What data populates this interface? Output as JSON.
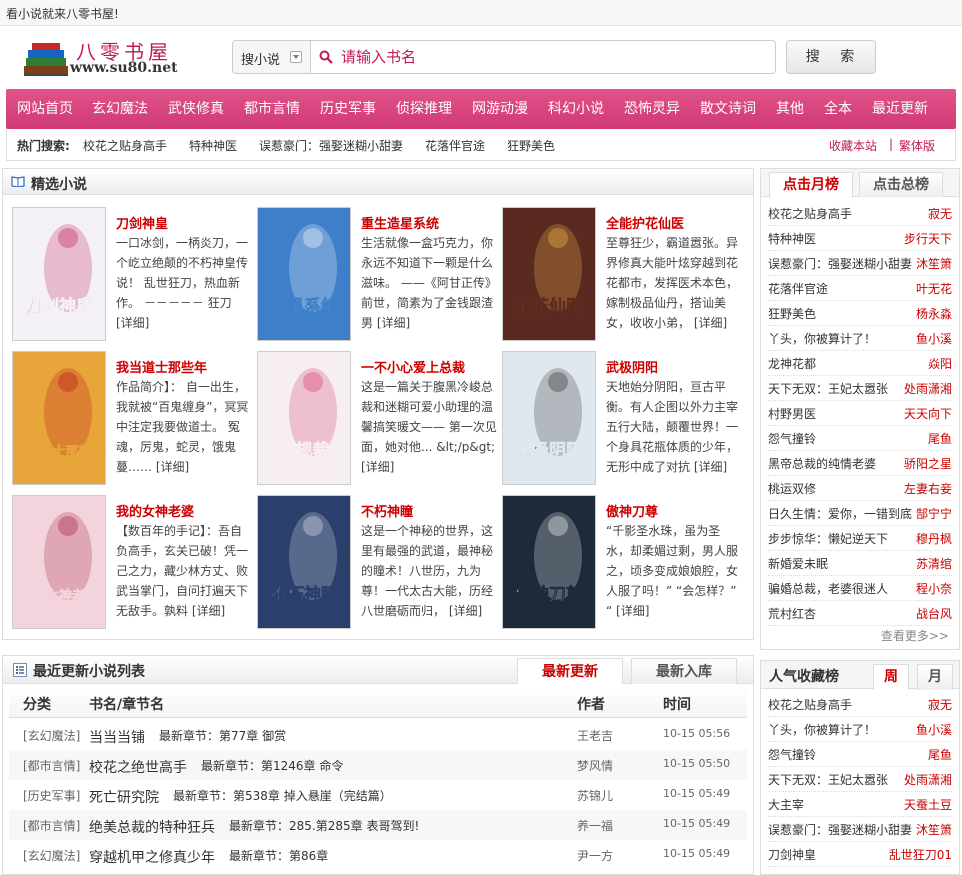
{
  "top_bar": {
    "text": "看小说就来八零书屋!"
  },
  "logo": {
    "name": "八零书屋",
    "url": "www.su80.net"
  },
  "search": {
    "type_label": "搜小说",
    "placeholder": "请输入书名",
    "button_label": "搜 索"
  },
  "nav": [
    "网站首页",
    "玄幻魔法",
    "武侠修真",
    "都市言情",
    "历史军事",
    "侦探推理",
    "网游动漫",
    "科幻小说",
    "恐怖灵异",
    "散文诗词",
    "其他",
    "全本",
    "最近更新"
  ],
  "hot_search": {
    "label": "热门搜索:",
    "items": [
      "校花之贴身高手",
      "特种神医",
      "误惹豪门：强娶迷糊小甜妻",
      "花落伴官途",
      "狂野美色"
    ],
    "bookmark": "收藏本站",
    "separator": "|",
    "traditional": "繁体版"
  },
  "featured": {
    "title": "精选小说",
    "books": [
      {
        "title": "刀剑神皇",
        "desc": "一口冰剑，一柄炎刀，一个屹立绝颠的不朽神皇传说！ 乱世狂刀，热血新作。 －－－－－ 狂刀",
        "more": "[详细]",
        "cover": {
          "text": "刀剑神皇",
          "bg": "#f3f0f6",
          "accent": "#c2185b"
        }
      },
      {
        "title": "重生造星系统",
        "desc": "生活就像一盒巧克力，你永远不知道下一颗是什么滋味。 ——《阿甘正传》 前世，简素为了金钱跟渣男",
        "more": "[详细]",
        "cover": {
          "text": "造星系统",
          "bg": "#3e7fc9",
          "accent": "#ffffff"
        }
      },
      {
        "title": "全能护花仙医",
        "desc": "至尊狂少，霸道嚣张。异界修真大能叶炫穿越到花花都市，发挥医术本色，嫁制极品仙丹，搭讪美女，收收小弟，",
        "more": "[详细]",
        "cover": {
          "text": "护花仙医",
          "bg": "#5a2a20",
          "accent": "#f6c14b"
        }
      },
      {
        "title": "我当道士那些年",
        "desc": "作品简介】： 自一出生，我就被“百鬼缠身”，冥冥中注定我要做道士。 冤魂，厉鬼，蛇灵，饿鬼蔓……",
        "more": "[详细]",
        "cover": {
          "text": "我当道士那些年",
          "bg": "#e8a53a",
          "accent": "#b5121b"
        }
      },
      {
        "title": "一不小心爱上总裁",
        "desc": "这是一篇关于腹黑冷峻总裁和迷糊可爱小助理的温馨搞笑暖文—— 第一次见面，她对他...",
        "desc2": "&lt;/p&gt;",
        "more": "[详细]",
        "cover": {
          "text": "潜规裁",
          "bg": "#f6eef0",
          "accent": "#d6336c"
        }
      },
      {
        "title": "武极阴阳",
        "desc": "天地始分阴阳，亘古平衡。有人企图以外力主宰五行大陆，颠覆世界！一个身具花瓶体质的少年，无形中成了对抗",
        "more": "[详细]",
        "cover": {
          "text": "武极阴阳",
          "bg": "#dfe7ef",
          "accent": "#2b2b2b"
        }
      },
      {
        "title": "我的女神老婆",
        "desc": "【数百年的手记】：吾自负高手，玄关已破！凭一己之力，藏少林方丈、败武当掌门，自问打遍天下无敌手。孰料",
        "more": "[详细]",
        "cover": {
          "text": "我的女神老婆",
          "bg": "#f3d4dc",
          "accent": "#a31d3d"
        }
      },
      {
        "title": "不朽神瞳",
        "desc": "这是一个神秘的世界，这里有最强的武道，最神秘的瞳术！八世历，九为尊！一代太古大能，历经八世磨砺而归，",
        "more": "[详细]",
        "cover": {
          "text": "不朽神瞳",
          "bg": "#2a3f6b",
          "accent": "#e6e6f0"
        }
      },
      {
        "title": "傲神刀尊",
        "desc": "“千影圣水珠，虽为圣水，却柔媚过剩，男人服之，顷多变成娘娘腔，女人服了吗！” “会怎样？” “",
        "more": "[详细]",
        "cover": {
          "text": "傲神刀尊",
          "bg": "#1c2a3a",
          "accent": "#ffffff"
        }
      }
    ]
  },
  "rank": {
    "tab_month": "点击月榜",
    "tab_total": "点击总榜",
    "items": [
      {
        "name": "校花之贴身高手",
        "author": "寂无"
      },
      {
        "name": "特种神医",
        "author": "步行天下"
      },
      {
        "name": "误惹豪门：强娶迷糊小甜妻",
        "author": "沐笙箫"
      },
      {
        "name": "花落伴官途",
        "author": "叶无花"
      },
      {
        "name": "狂野美色",
        "author": "杨永淼"
      },
      {
        "name": "丫头，你被算计了！",
        "author": "鱼小溪"
      },
      {
        "name": "龙神花都",
        "author": "焱阳"
      },
      {
        "name": "天下无双：王妃太嚣张",
        "author": "处雨潇湘"
      },
      {
        "name": "村野男医",
        "author": "天天向下"
      },
      {
        "name": "怨气撞铃",
        "author": "尾鱼"
      },
      {
        "name": "黑帝总裁的纯情老婆",
        "author": "骄阳之星"
      },
      {
        "name": "桃运双修",
        "author": "左妻右妾"
      },
      {
        "name": "日久生情：爱你，一错到底",
        "author": "郜宁宁"
      },
      {
        "name": "步步惊华：懒妃逆天下",
        "author": "穆丹枫"
      },
      {
        "name": "新婚爱未眠",
        "author": "苏清绾"
      },
      {
        "name": "骗婚总裁，老婆很迷人",
        "author": "程小奈"
      },
      {
        "name": "荒村红杏",
        "author": "战台风"
      }
    ],
    "more": "查看更多>>"
  },
  "updates": {
    "title": "最近更新小说列表",
    "tab_latest": "最新更新",
    "tab_new": "最新入库",
    "col_category": "分类",
    "col_book": "书名/章节名",
    "col_author": "作者",
    "col_time": "时间",
    "rows": [
      {
        "category": "[玄幻魔法]",
        "book": "当当当铺",
        "chapter": "最新章节：第77章 御赏",
        "author": "王老吉",
        "time": "10-15 05:56"
      },
      {
        "category": "[都市言情]",
        "book": "校花之绝世高手",
        "chapter": "最新章节：第1246章 命令",
        "author": "梦风情",
        "time": "10-15 05:50"
      },
      {
        "category": "[历史军事]",
        "book": "死亡研究院",
        "chapter": "最新章节：第538章 掉入悬崖（完结篇）",
        "author": "苏锦儿",
        "time": "10-15 05:49"
      },
      {
        "category": "[都市言情]",
        "book": "绝美总裁的特种狂兵",
        "chapter": "最新章节：285.第285章 表哥驾到!",
        "author": "养一福",
        "time": "10-15 05:49"
      },
      {
        "category": "[玄幻魔法]",
        "book": "穿越机甲之修真少年",
        "chapter": "最新章节：第86章",
        "author": "尹一方",
        "time": "10-15 05:49"
      }
    ]
  },
  "fav": {
    "title": "人气收藏榜",
    "tab_week": "周",
    "tab_month": "月",
    "items": [
      {
        "name": "校花之贴身高手",
        "author": "寂无"
      },
      {
        "name": "丫头，你被算计了！",
        "author": "鱼小溪"
      },
      {
        "name": "怨气撞铃",
        "author": "尾鱼"
      },
      {
        "name": "天下无双：王妃太嚣张",
        "author": "处雨潇湘"
      },
      {
        "name": "大主宰",
        "author": "天蚕土豆"
      },
      {
        "name": "误惹豪门：强娶迷糊小甜妻",
        "author": "沐笙箫"
      },
      {
        "name": "刀剑神皇",
        "author": "乱世狂刀01"
      }
    ]
  }
}
